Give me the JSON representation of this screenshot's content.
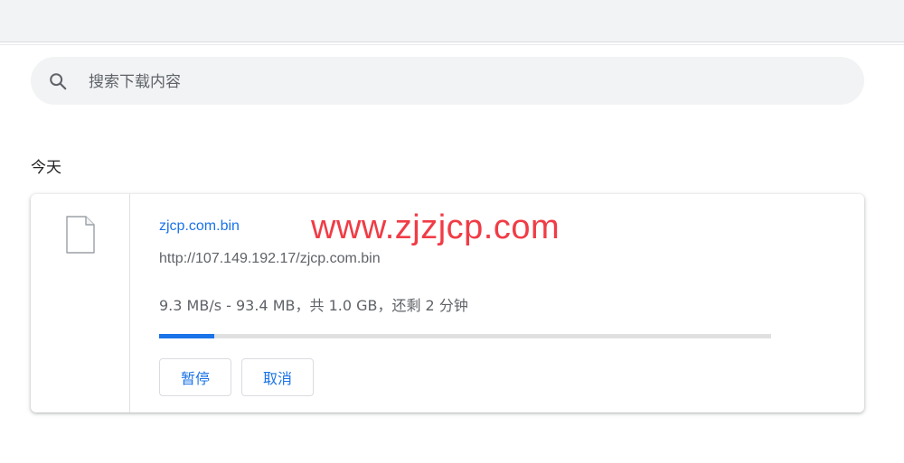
{
  "search": {
    "placeholder": "搜索下载内容",
    "value": "",
    "icon": "search-icon"
  },
  "section": {
    "title": "今天"
  },
  "download": {
    "file_name": "zjcp.com.bin",
    "url": "http://107.149.192.17/zjcp.com.bin",
    "status": "9.3 MB/s - 93.4 MB，共 1.0 GB，还剩 2 分钟",
    "progress_fraction": 0.09,
    "file_icon": "file-icon",
    "pause_label": "暂停",
    "cancel_label": "取消"
  },
  "watermark": {
    "text": "www.zjzjcp.com"
  },
  "colors": {
    "accent": "#1a73e8",
    "watermark": "#f03c46",
    "search_bg": "#f1f3f4"
  }
}
